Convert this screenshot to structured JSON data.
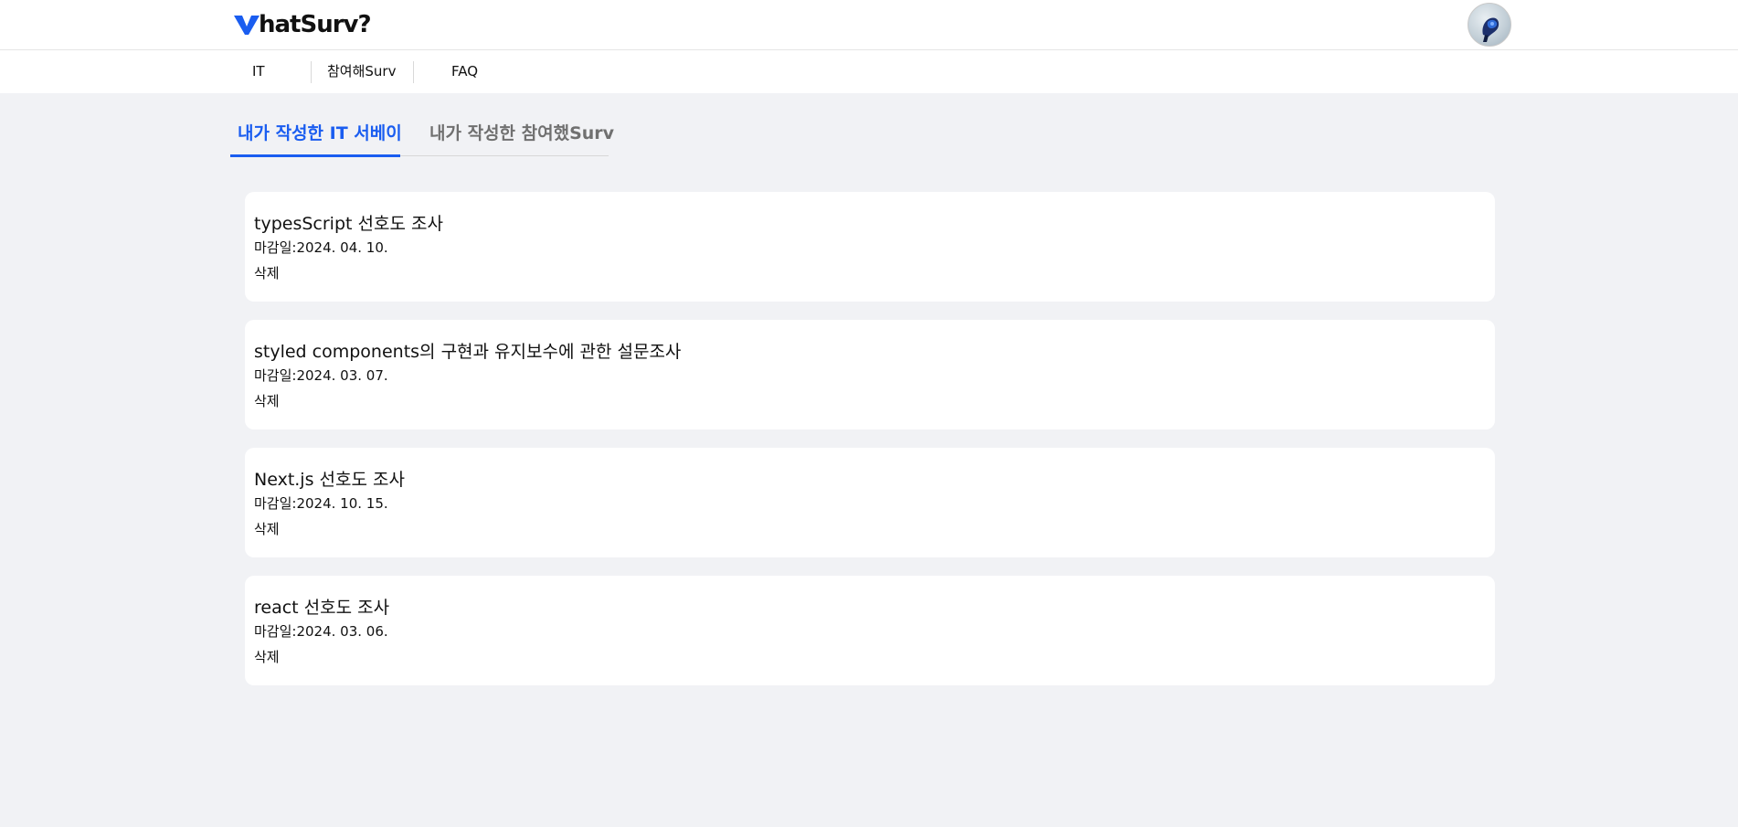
{
  "header": {
    "logo_text": "hatSurv?",
    "brand_color": "#1a5df0"
  },
  "nav": {
    "items": [
      {
        "label": "IT"
      },
      {
        "label": "참여해Surv"
      },
      {
        "label": "FAQ"
      }
    ]
  },
  "tabs": [
    {
      "label": "내가 작성한 IT 서베이",
      "active": true
    },
    {
      "label": "내가 작성한 참여했Surv",
      "active": false
    }
  ],
  "surveys": [
    {
      "title": "typesScript 선호도 조사",
      "deadline_label": "마감일:",
      "deadline": "2024. 04. 10.",
      "delete_label": "삭제"
    },
    {
      "title": "styled components의 구현과 유지보수에 관한 설문조사",
      "deadline_label": "마감일:",
      "deadline": "2024. 03. 07.",
      "delete_label": "삭제"
    },
    {
      "title": "Next.js 선호도 조사",
      "deadline_label": "마감일:",
      "deadline": "2024. 10. 15.",
      "delete_label": "삭제"
    },
    {
      "title": "react 선호도 조사",
      "deadline_label": "마감일:",
      "deadline": "2024. 03. 06.",
      "delete_label": "삭제"
    }
  ]
}
